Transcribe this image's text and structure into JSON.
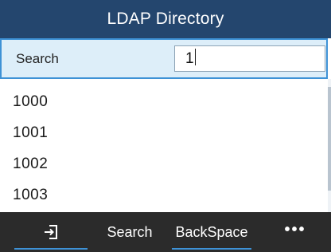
{
  "header": {
    "title": "LDAP Directory"
  },
  "search": {
    "label": "Search",
    "value": "1"
  },
  "results": [
    "1000",
    "1001",
    "1002",
    "1003"
  ],
  "softkeys": {
    "exit_icon": "exit-icon",
    "search_label": "Search",
    "backspace_label": "BackSpace",
    "more_label": "•••"
  },
  "colors": {
    "title_bar": "#24466e",
    "highlight_bg": "#ddeef9",
    "highlight_border": "#3e92d6",
    "softkey_bar": "#2b2b2b",
    "accent": "#3e92d6"
  }
}
